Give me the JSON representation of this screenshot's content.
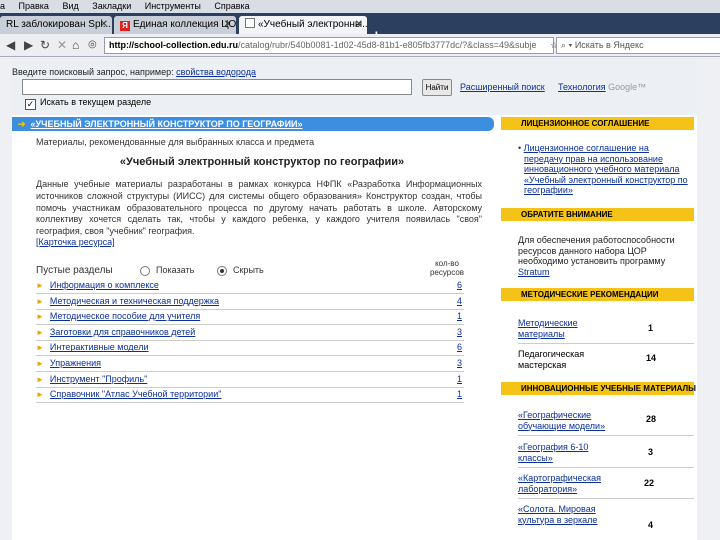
{
  "browser": {
    "menu": [
      "а",
      "Правка",
      "Вид",
      "Закладки",
      "Инструменты",
      "Справка"
    ],
    "tabs": [
      {
        "label": "RL заблокирован Spl..."
      },
      {
        "label": "Единая коллекция ЦО..."
      },
      {
        "label": "«Учебный электронны..."
      }
    ],
    "url_domain": "http://school-collection.edu.ru",
    "url_rest": "/catalog/rubr/540b0081-1d02-45d8-81b1-e805fb3777dc/?&class=49&subje",
    "yandex_placeholder": "Искать в Яндекс",
    "icons": {
      "back": "back-arrow-icon",
      "forward": "forward-arrow-icon",
      "reload": "reload-icon",
      "stop": "stop-icon",
      "home": "home-icon",
      "newtab": "plus-icon"
    }
  },
  "search": {
    "hint": "Введите поисковый запрос, например:",
    "hint_link": "свойства водорода",
    "find_button": "Найти",
    "advanced": "Расширенный поиск",
    "technology": "Технология",
    "google": "Google™",
    "checkbox_label": "Искать в текущем разделе"
  },
  "main": {
    "header": "«УЧЕБНЫЙ ЭЛЕКТРОННЫЙ КОНСТРУКТОР ПО ГЕОГРАФИИ»",
    "subtitle": "Материалы, рекомендованные для выбранных класса и предмета",
    "title": "«Учебный электронный конструктор по географии»",
    "description": "Данные учебные материалы разработаны в рамках конкурса НФПК «Разработка Информационных источников сложной структуры (ИИСС) для системы общего образования» Конструктор создан, чтобы помочь участникам образовательного процесса по другому начать работать в школе. Авторскому коллективу хочется сделать так, чтобы у каждого ребенка, у каждого учителя появилась \"своя\" география, своя \"учебник\" география.",
    "card_link": "[Карточка ресурса]",
    "empty_sections": "Пустые разделы",
    "show": "Показать",
    "hide": "Скрыть",
    "count_header": "кол-во ресурсов",
    "sections": [
      {
        "name": "Информация о комплексе",
        "count": "6"
      },
      {
        "name": "Методическая и техническая поддержка",
        "count": "4"
      },
      {
        "name": "Методическое пособие для учителя",
        "count": "1"
      },
      {
        "name": "Заготовки для справочников детей",
        "count": "3"
      },
      {
        "name": "Интерактивные модели",
        "count": "6"
      },
      {
        "name": "Упражнения",
        "count": "3"
      },
      {
        "name": "Инструмент \"Профиль\"",
        "count": "1"
      },
      {
        "name": "Справочник \"Атлас Учебной территории\"",
        "count": "1"
      }
    ]
  },
  "sidebar": {
    "license_title": "ЛИЦЕНЗИОННОЕ СОГЛАШЕНИЕ",
    "license_link1": "Лицензионное соглашение на передачу прав на использование инновационного учебного материала",
    "license_link1_lines": [
      "Лицензионное соглашение на",
      "передачу прав на использование",
      "инновационного учебного материала"
    ],
    "license_link2_lines": [
      "«Учебный электронный конструктор по",
      "географии»"
    ],
    "attention_title": "ОБРАТИТЕ ВНИМАНИЕ",
    "attention_lines": [
      "Для обеспечения работоспособности",
      "ресурсов данного набора ЦОР",
      "необходимо установить программу"
    ],
    "attention_link": "Stratum",
    "method_title": "МЕТОДИЧЕСКИЕ РЕКОМЕНДАЦИИ",
    "method_items": [
      {
        "lines": [
          "Методические",
          "материалы"
        ],
        "count": "1"
      },
      {
        "lines": [
          "Педагогическая",
          "мастерская"
        ],
        "count": "14"
      }
    ],
    "innov_title": "ИННОВАЦИОННЫЕ УЧЕБНЫЕ МАТЕРИАЛЫ",
    "innov_items": [
      {
        "lines": [
          "«Географические",
          "обучающие модели»"
        ],
        "count": "28"
      },
      {
        "lines": [
          "«География 6-10",
          "классы»"
        ],
        "count": "3"
      },
      {
        "lines": [
          "«Картографическая",
          "лаборатория»"
        ],
        "count": "22"
      },
      {
        "lines": [
          "«Солота. Мировая",
          "культура в зеркале"
        ],
        "count": "4"
      }
    ]
  }
}
